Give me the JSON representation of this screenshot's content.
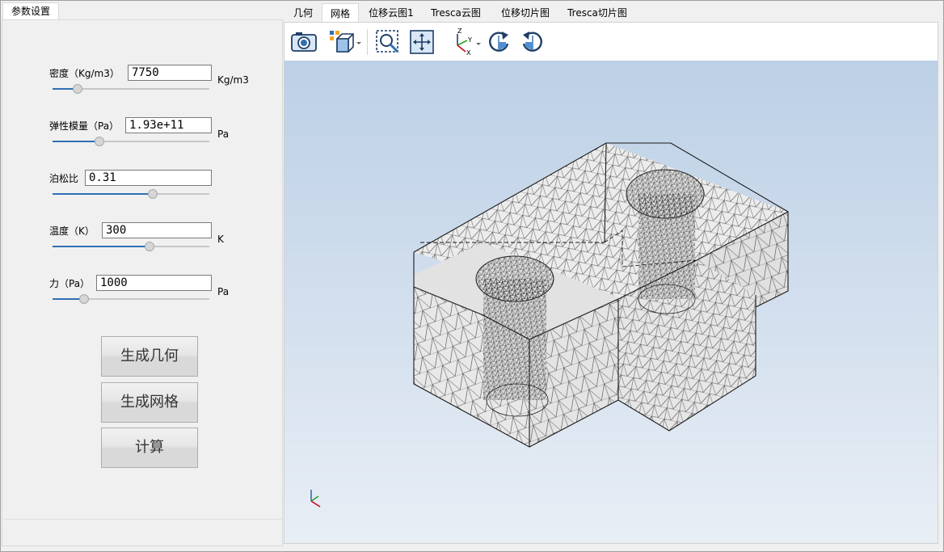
{
  "left_tab": {
    "label": "参数设置"
  },
  "params": {
    "density": {
      "label": "密度（Kg/m3）",
      "value": "7750",
      "unit": "Kg/m3",
      "slider": 0.16
    },
    "modulus": {
      "label": "弹性模量（Pa）",
      "value": "1.93e+11",
      "unit": "Pa",
      "slider": 0.3
    },
    "poisson": {
      "label": "泊松比",
      "value": "0.31",
      "unit": "",
      "slider": 0.64
    },
    "temperature": {
      "label": "温度（K）",
      "value": "300",
      "unit": "K",
      "slider": 0.62
    },
    "force": {
      "label": "力（Pa）",
      "value": "1000",
      "unit": "Pa",
      "slider": 0.2
    }
  },
  "buttons": {
    "geometry": "生成几何",
    "mesh": "生成网格",
    "compute": "计算"
  },
  "tabs": [
    {
      "label": "几何",
      "active": false
    },
    {
      "label": "网格",
      "active": true
    },
    {
      "label": "位移云图1",
      "active": false
    },
    {
      "label": "Tresca云图",
      "active": false
    },
    {
      "label": "位移切片图",
      "active": false
    },
    {
      "label": "Tresca切片图",
      "active": false
    }
  ],
  "toolbar": {
    "icons": [
      "camera-icon",
      "view-cube-icon",
      "zoom-box-icon",
      "fit-view-icon",
      "axis-orientation-icon",
      "rotate-cw-icon",
      "rotate-ccw-icon"
    ],
    "axis_labels": {
      "z": "Z",
      "y": "Y",
      "x": "X"
    }
  },
  "colors": {
    "accent": "#2f6fb4",
    "viewport_top": "#bcd0e6",
    "viewport_bottom": "#e9eef5",
    "mesh_line": "#2a2a2a"
  }
}
